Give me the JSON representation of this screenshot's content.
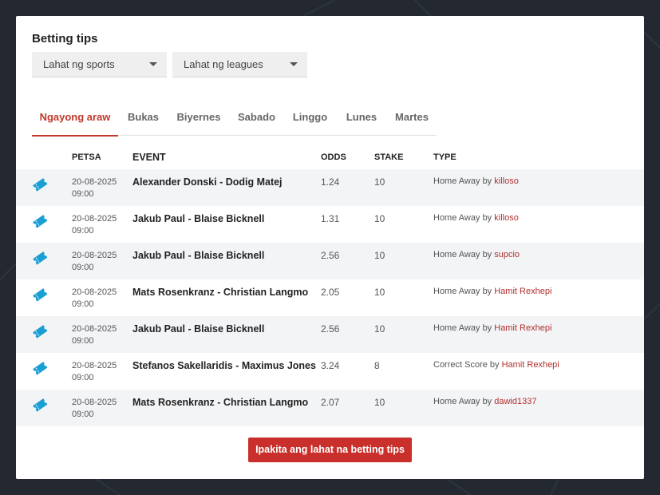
{
  "header": {
    "title": "Betting tips"
  },
  "filters": {
    "sports": "Lahat ng sports",
    "leagues": "Lahat ng leagues"
  },
  "tabs": [
    {
      "label": "Ngayong araw",
      "active": true
    },
    {
      "label": "Bukas",
      "active": false
    },
    {
      "label": "Biyernes",
      "active": false
    },
    {
      "label": "Sabado",
      "active": false
    },
    {
      "label": "Linggo",
      "active": false
    },
    {
      "label": "Lunes",
      "active": false
    },
    {
      "label": "Martes",
      "active": false
    }
  ],
  "table": {
    "columns": [
      "PETSA",
      "EVENT",
      "ODDS",
      "STAKE",
      "TYPE"
    ],
    "by_word": "by",
    "rows": [
      {
        "date": "20-08-2025",
        "time": "09:00",
        "event": "Alexander Donski - Dodig Matej",
        "odds": "1.24",
        "stake": "10",
        "type": "Home Away",
        "user": "killoso"
      },
      {
        "date": "20-08-2025",
        "time": "09:00",
        "event": "Jakub Paul - Blaise Bicknell",
        "odds": "1.31",
        "stake": "10",
        "type": "Home Away",
        "user": "killoso"
      },
      {
        "date": "20-08-2025",
        "time": "09:00",
        "event": "Jakub Paul - Blaise Bicknell",
        "odds": "2.56",
        "stake": "10",
        "type": "Home Away",
        "user": "supcio"
      },
      {
        "date": "20-08-2025",
        "time": "09:00",
        "event": "Mats Rosenkranz - Christian Langmo",
        "odds": "2.05",
        "stake": "10",
        "type": "Home Away",
        "user": "Hamit Rexhepi"
      },
      {
        "date": "20-08-2025",
        "time": "09:00",
        "event": "Jakub Paul - Blaise Bicknell",
        "odds": "2.56",
        "stake": "10",
        "type": "Home Away",
        "user": "Hamit Rexhepi"
      },
      {
        "date": "20-08-2025",
        "time": "09:00",
        "event": "Stefanos Sakellaridis - Maximus Jones",
        "odds": "3.24",
        "stake": "8",
        "type": "Correct Score",
        "user": "Hamit Rexhepi"
      },
      {
        "date": "20-08-2025",
        "time": "09:00",
        "event": "Mats Rosenkranz - Christian Langmo",
        "odds": "2.07",
        "stake": "10",
        "type": "Home Away",
        "user": "dawid1337"
      }
    ]
  },
  "footer": {
    "show_all_label": "Ipakita ang lahat na betting tips"
  },
  "colors": {
    "accent": "#c0392b",
    "icon": "#1a9fd4",
    "background": "#232831"
  },
  "icons": {
    "row_icon": "ticket-icon"
  }
}
